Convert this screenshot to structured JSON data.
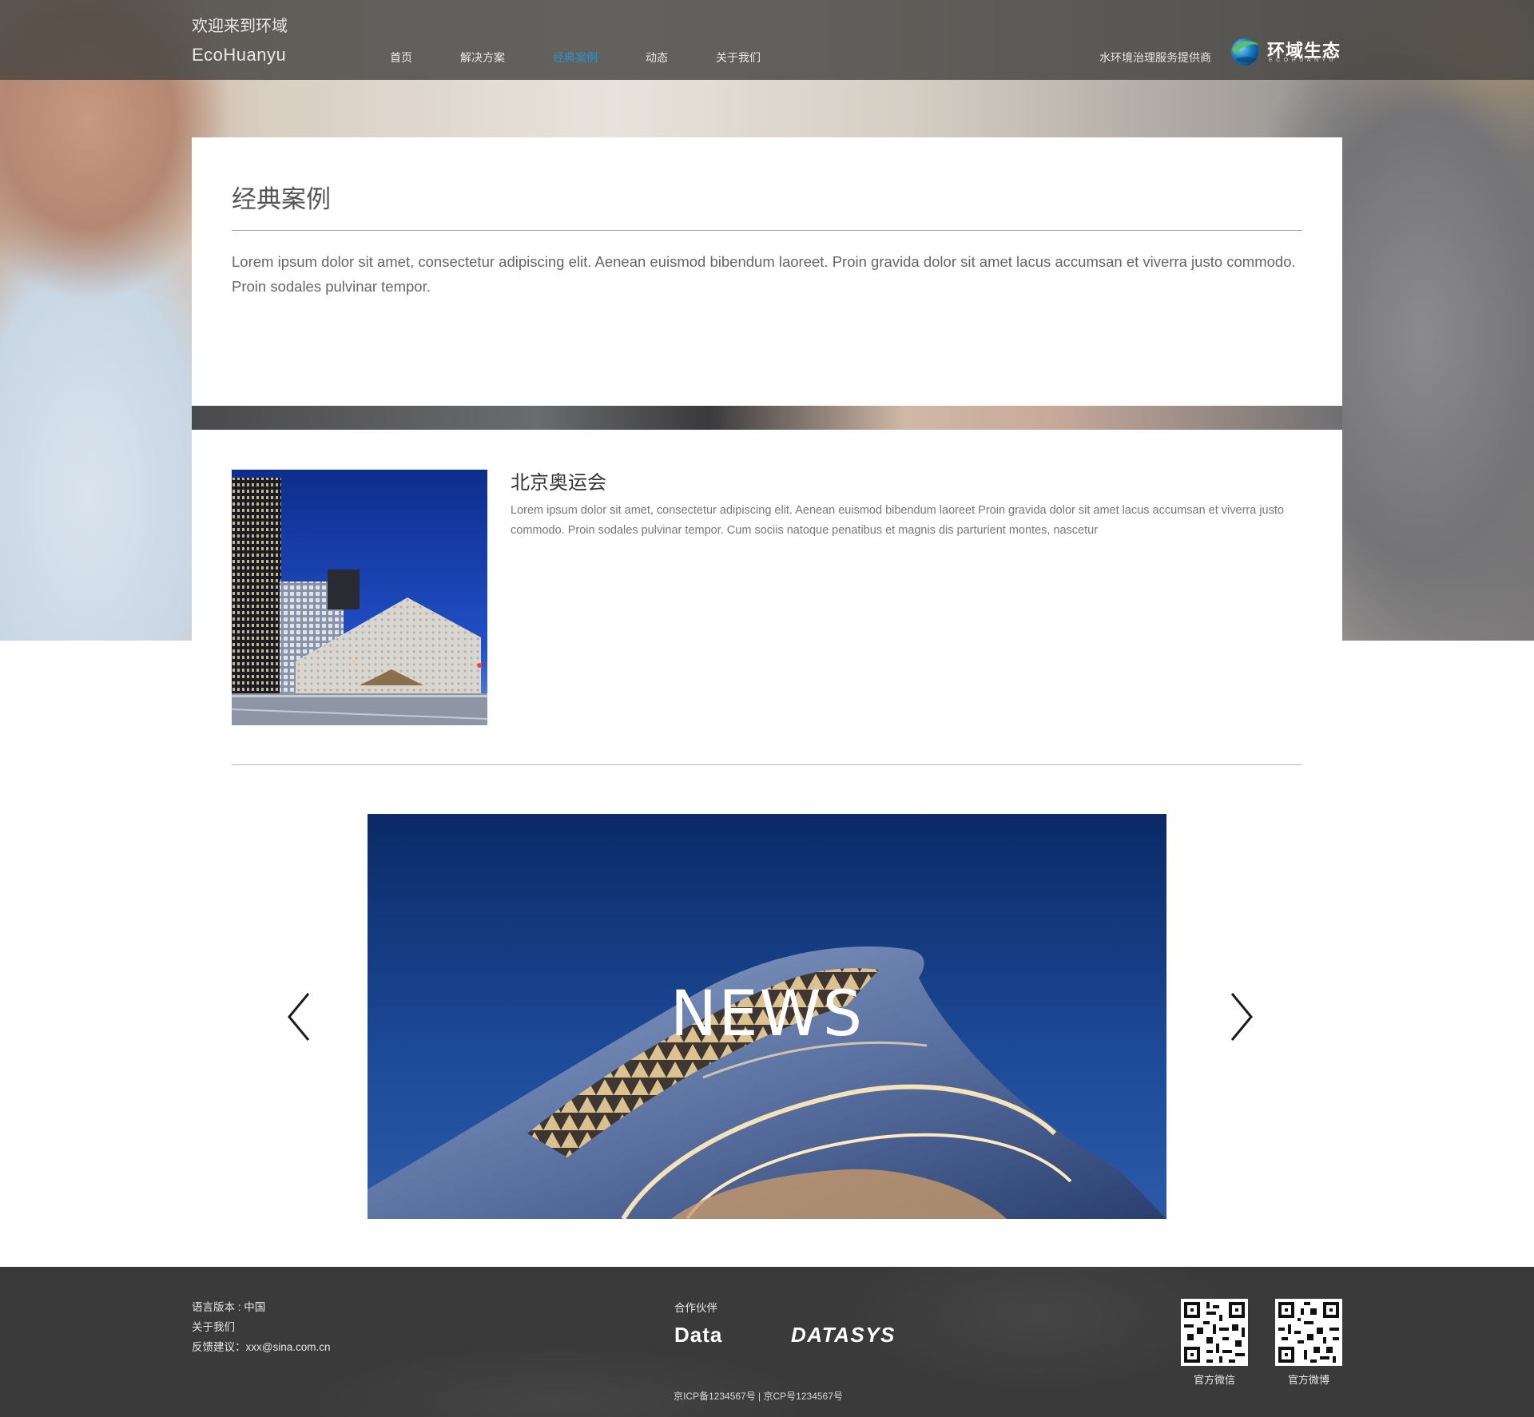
{
  "header": {
    "welcome": "欢迎来到环域",
    "brand": "EcoHuanyu",
    "nav": [
      {
        "label": "首页",
        "active": false
      },
      {
        "label": "解决方案",
        "active": false
      },
      {
        "label": "经典案例",
        "active": true
      },
      {
        "label": "动态",
        "active": false
      },
      {
        "label": "关于我们",
        "active": false
      }
    ],
    "tagline": "水环境治理服务提供商",
    "logo_text": "环域生态",
    "logo_sub": "ECOHUANYU"
  },
  "intro": {
    "title": "经典案例",
    "text": "Lorem ipsum dolor sit amet, consectetur adipiscing elit. Aenean euismod bibendum laoreet. Proin gravida dolor sit amet lacus accumsan et viverra justo commodo. Proin sodales pulvinar tempor."
  },
  "case": {
    "title": "北京奥运会",
    "text": "Lorem ipsum dolor sit amet, consectetur adipiscing elit. Aenean euismod bibendum laoreet Proin gravida dolor sit amet lacus accumsan et viverra justo commodo. Proin sodales pulvinar tempor. Cum sociis natoque penatibus et magnis dis parturient montes, nascetur"
  },
  "news": {
    "label": "NEWS"
  },
  "footer": {
    "language": "语言版本 : 中国",
    "about": "关于我们",
    "feedback": "反馈建议：xxx@sina.com.cn",
    "partners_label": "合作伙伴",
    "partners": [
      "Data",
      "DATASYS"
    ],
    "icp": "京ICP备1234567号  |  京CP号1234567号",
    "qr_wechat_label": "官方微信",
    "qr_weibo_label": "官方微博"
  },
  "colors": {
    "accent": "#2f8fc7",
    "header_bg": "#464442",
    "footer_bg": "#3a3a3a",
    "card_bg": "#ffffff"
  },
  "icons": {
    "prev": "chevron-left-icon",
    "next": "chevron-right-icon",
    "logo": "globe-logo-icon"
  }
}
